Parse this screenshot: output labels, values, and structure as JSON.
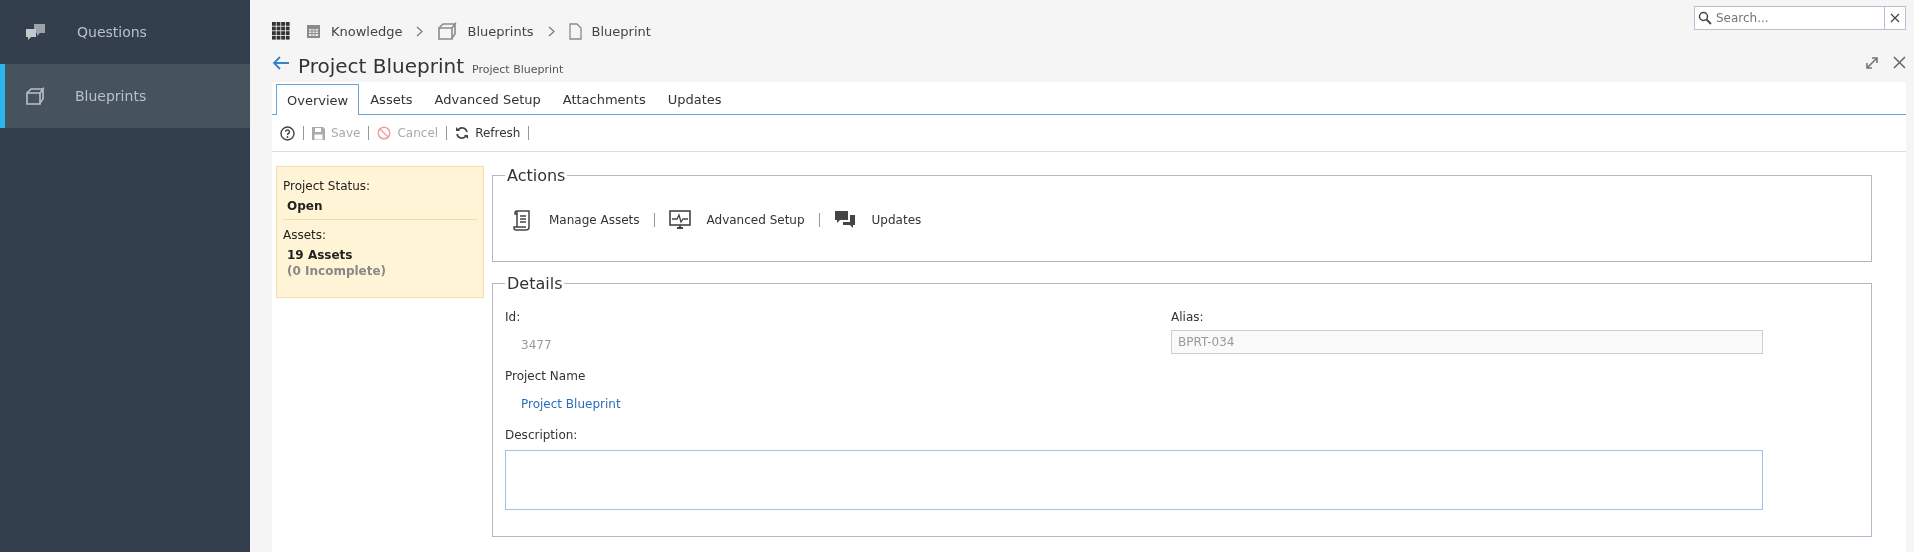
{
  "sidebar": {
    "items": [
      {
        "label": "Questions",
        "kind": "qa",
        "selected": false
      },
      {
        "label": "Blueprints",
        "kind": "box",
        "selected": true
      }
    ]
  },
  "breadcrumbs": [
    {
      "label": "Knowledge",
      "kind": "calendar"
    },
    {
      "label": "Blueprints",
      "kind": "box"
    },
    {
      "label": "Blueprint",
      "kind": "page"
    }
  ],
  "search": {
    "placeholder": "Search..."
  },
  "page": {
    "title": "Project Blueprint",
    "subtitle": "Project Blueprint"
  },
  "tabs": [
    {
      "label": "Overview",
      "selected": true
    },
    {
      "label": "Assets",
      "selected": false
    },
    {
      "label": "Advanced Setup",
      "selected": false
    },
    {
      "label": "Attachments",
      "selected": false
    },
    {
      "label": "Updates",
      "selected": false
    }
  ],
  "toolbar": [
    {
      "kind": "help",
      "disabled": false
    },
    {
      "kind": "save",
      "label": "Save",
      "disabled": true
    },
    {
      "kind": "cancel",
      "label": "Cancel",
      "disabled": true
    },
    {
      "kind": "refresh",
      "label": "Refresh",
      "disabled": false
    }
  ],
  "summary": [
    {
      "label": "Project Status:",
      "values": [
        "Open"
      ]
    },
    {
      "label": "Assets:",
      "values": [
        "19 Assets"
      ],
      "note": "(0 Incomplete)"
    }
  ],
  "actions": {
    "title": "Actions",
    "items": [
      {
        "label": "Manage Assets",
        "kind": "scroll"
      },
      {
        "label": "Advanced Setup",
        "kind": "monitor"
      },
      {
        "label": "Updates",
        "kind": "chat"
      }
    ]
  },
  "details": {
    "title": "Details",
    "id": {
      "label": "Id:",
      "value": "3477"
    },
    "alias": {
      "label": "Alias:",
      "value": "BPRT-034"
    },
    "project_name": {
      "label": "Project Name",
      "value": "Project Blueprint"
    },
    "description": {
      "label": "Description:"
    }
  }
}
